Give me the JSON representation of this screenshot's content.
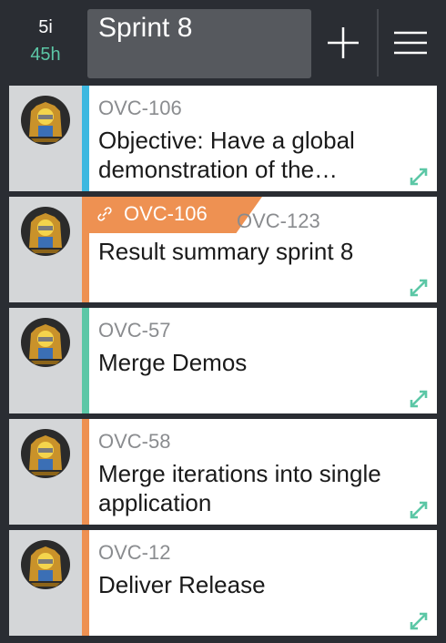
{
  "header": {
    "item_count": "5i",
    "hours": "45h",
    "title": "Sprint 8",
    "add_icon": "plus-icon",
    "menu_icon": "hamburger-menu-icon"
  },
  "colors": {
    "background": "#2a2d33",
    "hours_green": "#5cc7a6",
    "stripe_blue": "#3db8e0",
    "stripe_orange": "#ee9152",
    "stripe_teal": "#5cc7a6",
    "expand_icon": "#5cc7a6"
  },
  "cards": [
    {
      "key": "OVC-106",
      "summary": "Objective: Have a global demonstration of the…",
      "stripe": "#3db8e0"
    },
    {
      "key": "OVC-123",
      "parent_key": "OVC-106",
      "summary": "Result summary sprint 8",
      "stripe": "#ee9152"
    },
    {
      "key": "OVC-57",
      "summary": "Merge Demos",
      "stripe": "#5cc7a6"
    },
    {
      "key": "OVC-58",
      "summary": "Merge iterations into single application",
      "stripe": "#ee9152"
    },
    {
      "key": "OVC-12",
      "summary": "Deliver Release",
      "stripe": "#ee9152"
    }
  ]
}
